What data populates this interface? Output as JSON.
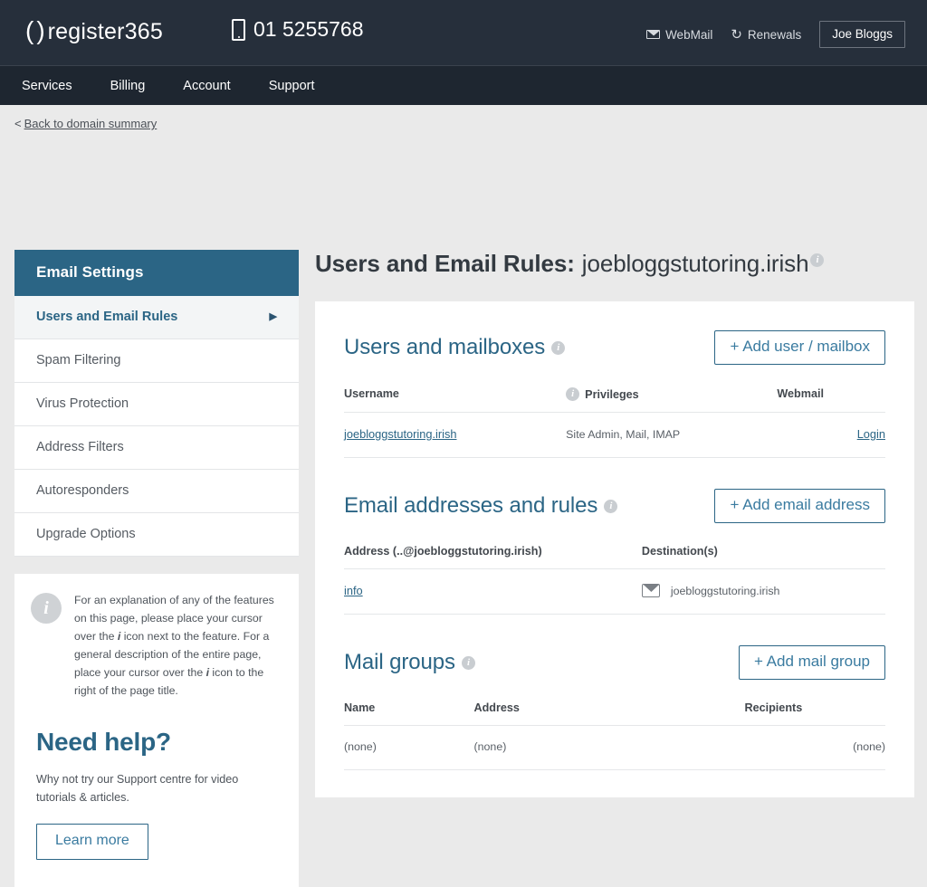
{
  "header": {
    "logo_paren_left": "(",
    "logo_paren_right": ")",
    "logo_word": "register365",
    "phone": "01 5255768",
    "phone_icon": "mobile-phone-icon",
    "webmail_label": "WebMail",
    "webmail_icon": "envelope-icon",
    "renewals_label": "Renewals",
    "renewals_icon": "refresh-icon",
    "user_label": "Joe Bloggs"
  },
  "nav": {
    "items": [
      {
        "label": "Services"
      },
      {
        "label": "Billing"
      },
      {
        "label": "Account"
      },
      {
        "label": "Support"
      }
    ]
  },
  "breadcrumb": {
    "prefix": "<",
    "label": "Back to domain summary"
  },
  "sidebar": {
    "heading": "Email Settings",
    "items": [
      {
        "label": "Users and Email Rules",
        "active": true,
        "caret": "▶"
      },
      {
        "label": "Spam Filtering",
        "active": false
      },
      {
        "label": "Virus Protection",
        "active": false
      },
      {
        "label": "Address Filters",
        "active": false
      },
      {
        "label": "Autoresponders",
        "active": false
      },
      {
        "label": "Upgrade Options",
        "active": false
      }
    ],
    "info_box": {
      "icon": "info-icon",
      "text_part1": "For an explanation of any of the features on this page, please place your cursor over the ",
      "italic1": "i",
      "text_part2": " icon next to the feature. For a general description of the entire page, place your cursor over the ",
      "italic2": "i",
      "text_part3": " icon to the right of the page title."
    },
    "help_box": {
      "title": "Need help?",
      "text": "Why not try our Support centre for video tutorials & articles.",
      "button_label": "Learn more"
    }
  },
  "main": {
    "page_title_label": "Users and Email Rules:",
    "page_title_domain": "joebloggstutoring.irish",
    "sections": [
      {
        "title": "Users and mailboxes",
        "button_label": "+ Add user / mailbox",
        "columns": [
          "Username",
          "Privileges",
          "Webmail"
        ],
        "rows": [
          {
            "username": "joebloggstutoring.irish",
            "privileges": "Site Admin, Mail, IMAP",
            "webmail": "Login"
          }
        ]
      },
      {
        "title": "Email addresses and rules",
        "button_label": "+ Add email address",
        "columns": [
          "Address (..@joebloggstutoring.irish)",
          "Destination(s)"
        ],
        "rows": [
          {
            "address": "info",
            "destination": "joebloggstutoring.irish",
            "destination_icon": "envelope-icon"
          }
        ]
      },
      {
        "title": "Mail groups",
        "button_label": "+ Add mail group",
        "columns": [
          "Name",
          "Address",
          "Recipients"
        ],
        "rows": [
          {
            "name": "(none)",
            "address": "(none)",
            "recipients": "(none)"
          }
        ]
      }
    ]
  },
  "colors": {
    "header_bg": "#262f3b",
    "nav_bg": "#1e2630",
    "accent_blue": "#2b6585",
    "link_blue": "#3a7ba0",
    "page_bg": "#eaeaea",
    "info_gray": "#c9cdd1"
  }
}
